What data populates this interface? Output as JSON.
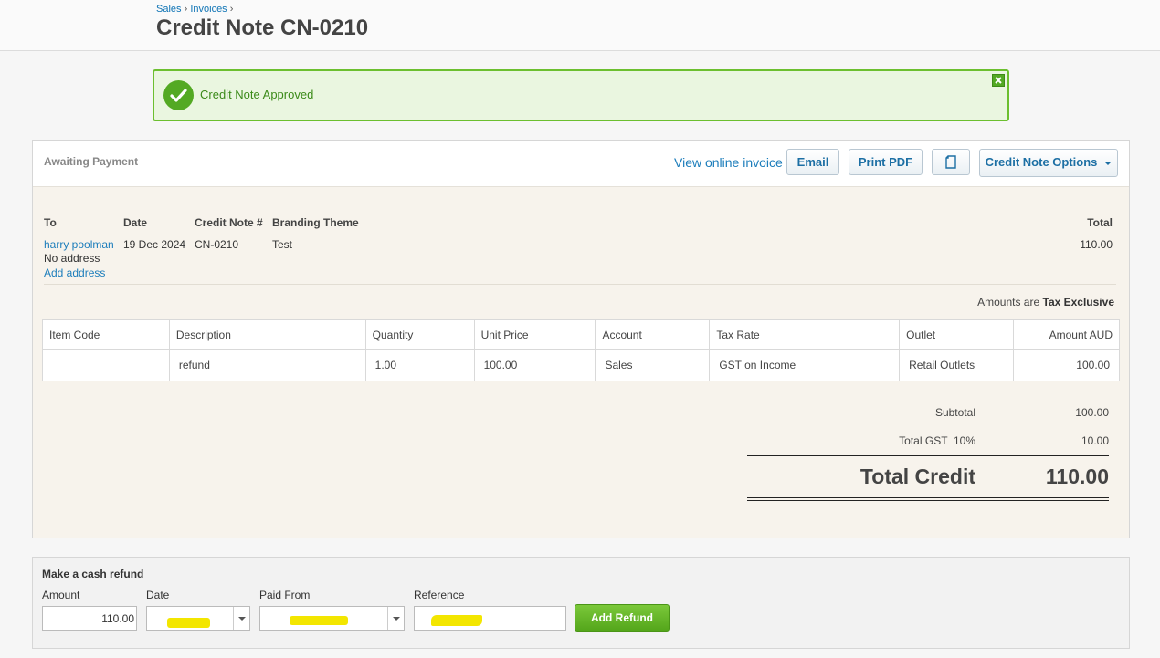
{
  "breadcrumb": {
    "sales": "Sales",
    "invoices": "Invoices",
    "sep": "›"
  },
  "page_title": "Credit Note CN-0210",
  "alert": {
    "message": "Credit Note Approved",
    "color": "#53a923"
  },
  "card": {
    "status": "Awaiting Payment",
    "view_online": "View online invoice",
    "email": "Email",
    "print_pdf": "Print PDF",
    "options": "Credit Note Options"
  },
  "details": {
    "to_label": "To",
    "to_name": "harry poolman",
    "no_address": "No address",
    "add_address": "Add address",
    "date_label": "Date",
    "date_value": "19 Dec 2024",
    "number_label": "Credit Note #",
    "number_value": "CN-0210",
    "theme_label": "Branding Theme",
    "theme_value": "Test",
    "total_label": "Total",
    "total_value": "110.00"
  },
  "amounts_are": {
    "prefix": "Amounts are",
    "mode": "Tax Exclusive"
  },
  "table": {
    "headers": [
      "Item Code",
      "Description",
      "Quantity",
      "Unit Price",
      "Account",
      "Tax Rate",
      "Outlet",
      "Amount AUD"
    ],
    "rows": [
      {
        "item_code": "",
        "description": "refund",
        "quantity": "1.00",
        "unit_price": "100.00",
        "account": "Sales",
        "tax_rate": "GST on Income",
        "outlet": "Retail Outlets",
        "amount": "100.00"
      }
    ]
  },
  "totals": {
    "subtotal_label": "Subtotal",
    "subtotal": "100.00",
    "gst_label": "Total GST  10%",
    "gst": "10.00",
    "total_label": "Total Credit",
    "total": "110.00"
  },
  "refund": {
    "title": "Make a cash refund",
    "amount_label": "Amount",
    "amount_value": "110.00",
    "date_label": "Date",
    "paid_from_label": "Paid From",
    "reference_label": "Reference",
    "add_button": "Add Refund",
    "redaction_color": "#f3e600"
  }
}
